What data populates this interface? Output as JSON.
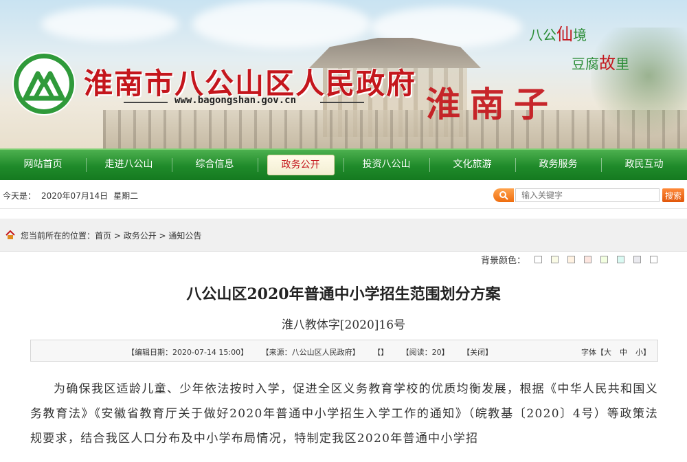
{
  "header": {
    "site_title": "淮南市八公山区人民政府",
    "site_url": "www.bagongshan.gov.cn",
    "calligraphy": "淮南子",
    "slogan1": {
      "pre": "八公",
      "accent": "仙",
      "post": "境"
    },
    "slogan2": {
      "pre": "豆腐",
      "accent": "故",
      "post": "里"
    }
  },
  "nav": {
    "items": [
      {
        "label": "网站首页",
        "active": false
      },
      {
        "label": "走进八公山",
        "active": false
      },
      {
        "label": "综合信息",
        "active": false
      },
      {
        "label": "政务公开",
        "active": true
      },
      {
        "label": "投资八公山",
        "active": false
      },
      {
        "label": "文化旅游",
        "active": false
      },
      {
        "label": "政务服务",
        "active": false
      },
      {
        "label": "政民互动",
        "active": false
      }
    ]
  },
  "infobar": {
    "today_label": "今天是：",
    "date": "2020年07月14日",
    "weekday": "星期二",
    "search_placeholder": "输入关键字",
    "search_button": "搜索"
  },
  "breadcrumb": {
    "prefix": "您当前所在的位置：",
    "items": [
      "首页",
      "政务公开",
      "通知公告"
    ],
    "separator": " > "
  },
  "article": {
    "bgcolor_label": "背景颜色：",
    "bgcolor_swatches": [
      "#ffffff",
      "#fafbe6",
      "#fff2e2",
      "#fde6e0",
      "#f3ffe1",
      "#dafaf3",
      "#eaeaef",
      "#ffffff"
    ],
    "title": "八公山区2020年普通中小学招生范围划分方案",
    "doc_no": "淮八教体字[2020]16号",
    "meta": {
      "edit_date": "【编辑日期：2020-07-14 15:00】",
      "source": "【来源：八公山区人民政府】",
      "blank": "【】",
      "reads": "【阅读：20】",
      "close": "【关闭】",
      "font_label": "字体【",
      "font_large": "大",
      "font_mid": "中",
      "font_small": "小",
      "font_end": "】"
    },
    "body": "为确保我区适龄儿童、少年依法按时入学，促进全区义务教育学校的优质均衡发展，根据《中华人民共和国义务教育法》《安徽省教育厅关于做好2020年普通中小学招生入学工作的通知》（皖教基〔2020〕4号）等政策法规要求，结合我区人口分布及中小学布局情况，特制定我区2020年普通中小学招"
  },
  "colors": {
    "brand_green": "#1f8a2a",
    "brand_red": "#c4161c",
    "search_orange": "#ef6d0e"
  }
}
